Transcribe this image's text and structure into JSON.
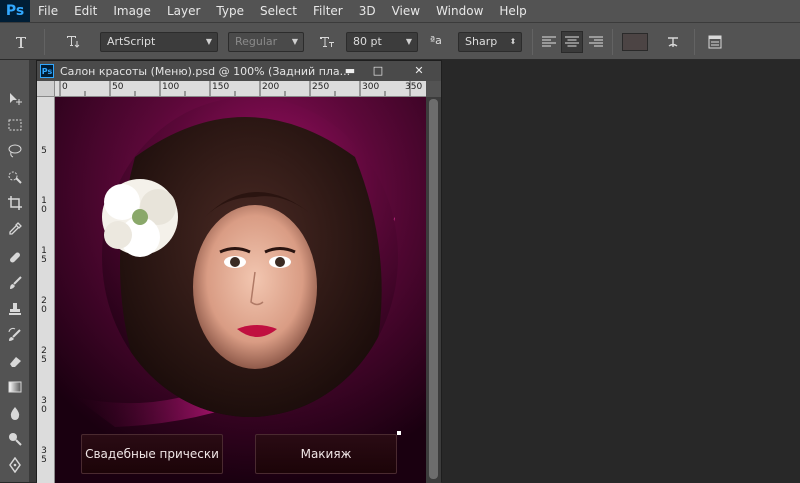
{
  "app": {
    "logo": "Ps"
  },
  "menu": [
    "File",
    "Edit",
    "Image",
    "Layer",
    "Type",
    "Select",
    "Filter",
    "3D",
    "View",
    "Window",
    "Help"
  ],
  "options": {
    "font_family": "ArtScript",
    "font_style": "Regular",
    "font_size": "80 pt",
    "anti_alias_label": "ªa",
    "anti_alias": "Sharp"
  },
  "document": {
    "title": "Салон красоты (Меню).psd @ 100% (Задний пла...",
    "ps_icon": "Ps",
    "minimize": "▬",
    "restore": "□",
    "close": "✕"
  },
  "ruler": {
    "top_labels": [
      "0",
      "50",
      "100",
      "150",
      "200",
      "250",
      "300",
      "350"
    ],
    "left_labels": [
      "5",
      "1 0",
      "1 5",
      "2 0",
      "2 5",
      "3 0",
      "3 5"
    ]
  },
  "canvas_menu": {
    "buttons": [
      "Свадебные прически",
      "Макияж"
    ]
  },
  "colors": {
    "accent": "#31a8ff",
    "canvas_bg": "#1b0012",
    "magenta": "#b0106a"
  }
}
